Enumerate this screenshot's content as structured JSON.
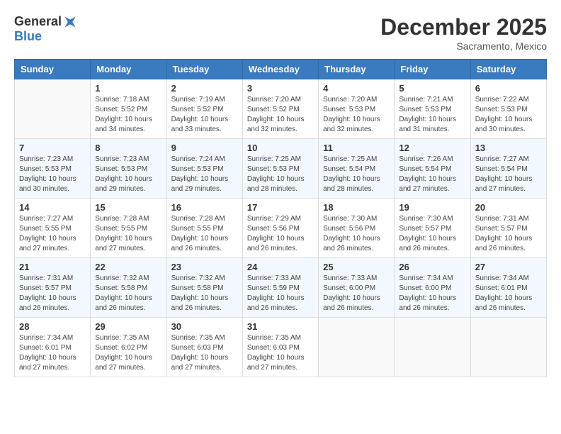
{
  "header": {
    "logo_general": "General",
    "logo_blue": "Blue",
    "month": "December 2025",
    "location": "Sacramento, Mexico"
  },
  "weekdays": [
    "Sunday",
    "Monday",
    "Tuesday",
    "Wednesday",
    "Thursday",
    "Friday",
    "Saturday"
  ],
  "weeks": [
    [
      {
        "day": "",
        "info": ""
      },
      {
        "day": "1",
        "info": "Sunrise: 7:18 AM\nSunset: 5:52 PM\nDaylight: 10 hours\nand 34 minutes."
      },
      {
        "day": "2",
        "info": "Sunrise: 7:19 AM\nSunset: 5:52 PM\nDaylight: 10 hours\nand 33 minutes."
      },
      {
        "day": "3",
        "info": "Sunrise: 7:20 AM\nSunset: 5:52 PM\nDaylight: 10 hours\nand 32 minutes."
      },
      {
        "day": "4",
        "info": "Sunrise: 7:20 AM\nSunset: 5:53 PM\nDaylight: 10 hours\nand 32 minutes."
      },
      {
        "day": "5",
        "info": "Sunrise: 7:21 AM\nSunset: 5:53 PM\nDaylight: 10 hours\nand 31 minutes."
      },
      {
        "day": "6",
        "info": "Sunrise: 7:22 AM\nSunset: 5:53 PM\nDaylight: 10 hours\nand 30 minutes."
      }
    ],
    [
      {
        "day": "7",
        "info": "Sunrise: 7:23 AM\nSunset: 5:53 PM\nDaylight: 10 hours\nand 30 minutes."
      },
      {
        "day": "8",
        "info": "Sunrise: 7:23 AM\nSunset: 5:53 PM\nDaylight: 10 hours\nand 29 minutes."
      },
      {
        "day": "9",
        "info": "Sunrise: 7:24 AM\nSunset: 5:53 PM\nDaylight: 10 hours\nand 29 minutes."
      },
      {
        "day": "10",
        "info": "Sunrise: 7:25 AM\nSunset: 5:53 PM\nDaylight: 10 hours\nand 28 minutes."
      },
      {
        "day": "11",
        "info": "Sunrise: 7:25 AM\nSunset: 5:54 PM\nDaylight: 10 hours\nand 28 minutes."
      },
      {
        "day": "12",
        "info": "Sunrise: 7:26 AM\nSunset: 5:54 PM\nDaylight: 10 hours\nand 27 minutes."
      },
      {
        "day": "13",
        "info": "Sunrise: 7:27 AM\nSunset: 5:54 PM\nDaylight: 10 hours\nand 27 minutes."
      }
    ],
    [
      {
        "day": "14",
        "info": "Sunrise: 7:27 AM\nSunset: 5:55 PM\nDaylight: 10 hours\nand 27 minutes."
      },
      {
        "day": "15",
        "info": "Sunrise: 7:28 AM\nSunset: 5:55 PM\nDaylight: 10 hours\nand 27 minutes."
      },
      {
        "day": "16",
        "info": "Sunrise: 7:28 AM\nSunset: 5:55 PM\nDaylight: 10 hours\nand 26 minutes."
      },
      {
        "day": "17",
        "info": "Sunrise: 7:29 AM\nSunset: 5:56 PM\nDaylight: 10 hours\nand 26 minutes."
      },
      {
        "day": "18",
        "info": "Sunrise: 7:30 AM\nSunset: 5:56 PM\nDaylight: 10 hours\nand 26 minutes."
      },
      {
        "day": "19",
        "info": "Sunrise: 7:30 AM\nSunset: 5:57 PM\nDaylight: 10 hours\nand 26 minutes."
      },
      {
        "day": "20",
        "info": "Sunrise: 7:31 AM\nSunset: 5:57 PM\nDaylight: 10 hours\nand 26 minutes."
      }
    ],
    [
      {
        "day": "21",
        "info": "Sunrise: 7:31 AM\nSunset: 5:57 PM\nDaylight: 10 hours\nand 26 minutes."
      },
      {
        "day": "22",
        "info": "Sunrise: 7:32 AM\nSunset: 5:58 PM\nDaylight: 10 hours\nand 26 minutes."
      },
      {
        "day": "23",
        "info": "Sunrise: 7:32 AM\nSunset: 5:58 PM\nDaylight: 10 hours\nand 26 minutes."
      },
      {
        "day": "24",
        "info": "Sunrise: 7:33 AM\nSunset: 5:59 PM\nDaylight: 10 hours\nand 26 minutes."
      },
      {
        "day": "25",
        "info": "Sunrise: 7:33 AM\nSunset: 6:00 PM\nDaylight: 10 hours\nand 26 minutes."
      },
      {
        "day": "26",
        "info": "Sunrise: 7:34 AM\nSunset: 6:00 PM\nDaylight: 10 hours\nand 26 minutes."
      },
      {
        "day": "27",
        "info": "Sunrise: 7:34 AM\nSunset: 6:01 PM\nDaylight: 10 hours\nand 26 minutes."
      }
    ],
    [
      {
        "day": "28",
        "info": "Sunrise: 7:34 AM\nSunset: 6:01 PM\nDaylight: 10 hours\nand 27 minutes."
      },
      {
        "day": "29",
        "info": "Sunrise: 7:35 AM\nSunset: 6:02 PM\nDaylight: 10 hours\nand 27 minutes."
      },
      {
        "day": "30",
        "info": "Sunrise: 7:35 AM\nSunset: 6:03 PM\nDaylight: 10 hours\nand 27 minutes."
      },
      {
        "day": "31",
        "info": "Sunrise: 7:35 AM\nSunset: 6:03 PM\nDaylight: 10 hours\nand 27 minutes."
      },
      {
        "day": "",
        "info": ""
      },
      {
        "day": "",
        "info": ""
      },
      {
        "day": "",
        "info": ""
      }
    ]
  ]
}
